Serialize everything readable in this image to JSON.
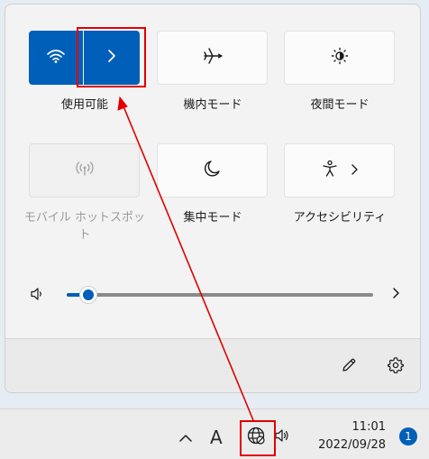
{
  "quick_settings": {
    "tiles": [
      {
        "id": "wifi",
        "label": "使用可能",
        "icon": "wifi-icon",
        "state": "on",
        "has_expand": true
      },
      {
        "id": "airplane",
        "label": "機内モード",
        "icon": "airplane-icon",
        "state": "off"
      },
      {
        "id": "night-light",
        "label": "夜間モード",
        "icon": "brightness-icon",
        "state": "off"
      },
      {
        "id": "hotspot",
        "label": "モバイル ホットスポット",
        "icon": "hotspot-icon",
        "state": "disabled"
      },
      {
        "id": "focus",
        "label": "集中モード",
        "icon": "moon-icon",
        "state": "off"
      },
      {
        "id": "accessibility",
        "label": "アクセシビリティ",
        "icon": "accessibility-icon",
        "state": "off",
        "has_expand": true
      }
    ],
    "volume": {
      "icon": "speaker-icon",
      "level_percent": 7,
      "expand_icon": "chevron-right-icon"
    },
    "footer": {
      "edit_icon": "pencil-icon",
      "settings_icon": "gear-icon"
    }
  },
  "taskbar": {
    "overflow_icon": "chevron-up-icon",
    "ime_label": "A",
    "network_icon": "globe-no-internet-icon",
    "volume_icon": "speaker-icon",
    "time": "11:01",
    "date": "2022/09/28",
    "notification_count": "1"
  },
  "colors": {
    "accent": "#005fb8",
    "annotation": "#e00000"
  }
}
